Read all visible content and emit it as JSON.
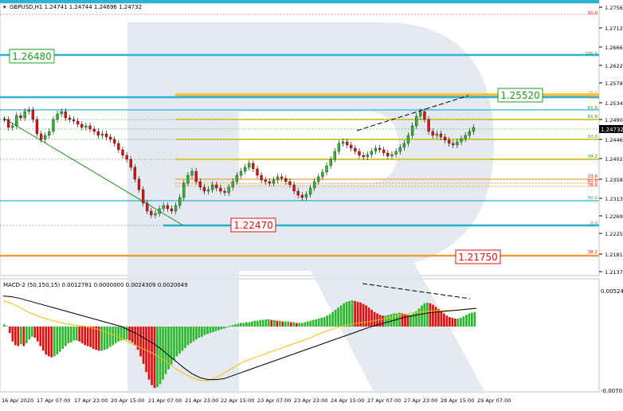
{
  "header": {
    "symbol_info": "GBPUSD,H1  1.24741 1.24744 1.24696 1.24732"
  },
  "macd": {
    "label": "MACD-2 (50,150,15) 0.0012781 0.0000000 0.0024309 0.0020049",
    "axis_top": "0.0052455",
    "axis_bottom": "-0.007019",
    "histogram": [
      0.0003,
      5e-05,
      -0.0007,
      -0.0016,
      -0.002,
      -0.0021,
      -0.0019,
      -0.0021,
      -0.0018,
      -0.0014,
      -0.0011,
      -0.0012,
      -0.0016,
      -0.0021,
      -0.0026,
      -0.003,
      -0.0032,
      -0.0033,
      -0.0032,
      -0.003,
      -0.0027,
      -0.0024,
      -0.0021,
      -0.0018,
      -0.0017,
      -0.0015,
      -0.0015,
      -0.0016,
      -0.0018,
      -0.002,
      -0.0021,
      -0.0022,
      -0.0024,
      -0.0025,
      -0.0026,
      -0.0026,
      -0.0025,
      -0.0024,
      -0.0022,
      -0.002,
      -0.0018,
      -0.0016,
      -0.0015,
      -0.0014,
      -0.0014,
      -0.0015,
      -0.0017,
      -0.002,
      -0.0025,
      -0.0032,
      -0.004,
      -0.0049,
      -0.0057,
      -0.0063,
      -0.0066,
      -0.0065,
      -0.0062,
      -0.0057,
      -0.0051,
      -0.0046,
      -0.0041,
      -0.0036,
      -0.0032,
      -0.0029,
      -0.0026,
      -0.0023,
      -0.002,
      -0.0018,
      -0.0016,
      -0.0014,
      -0.0012,
      -0.0011,
      -0.0009,
      -0.0008,
      -0.0007,
      -0.0006,
      -0.0005,
      -0.0004,
      -0.0003,
      -0.0002,
      -0.0001,
      0.0001,
      0.0002,
      0.0003,
      0.0004,
      0.0005,
      0.0005,
      0.0006,
      0.0006,
      0.0007,
      0.0008,
      0.0008,
      0.0009,
      0.0009,
      0.001,
      0.001,
      0.0009,
      0.0009,
      0.0008,
      0.0008,
      0.0007,
      0.0007,
      0.0007,
      0.0006,
      0.0006,
      0.0005,
      0.0005,
      0.0005,
      0.0006,
      0.0007,
      0.0008,
      0.0009,
      0.001,
      0.0011,
      0.0012,
      0.0013,
      0.0015,
      0.0017,
      0.002,
      0.0023,
      0.0026,
      0.0029,
      0.0032,
      0.0034,
      0.0035,
      0.0036,
      0.0035,
      0.0034,
      0.0033,
      0.0031,
      0.0029,
      0.0026,
      0.0023,
      0.002,
      0.0018,
      0.0016,
      0.0015,
      0.0015,
      0.0016,
      0.0017,
      0.0018,
      0.0018,
      0.0019,
      0.0018,
      0.0017,
      0.0016,
      0.0016,
      0.0018,
      0.0021,
      0.0025,
      0.0029,
      0.0032,
      0.0033,
      0.0032,
      0.003,
      0.0027,
      0.0024,
      0.0021,
      0.0018,
      0.0015,
      0.0013,
      0.0012,
      0.0011,
      0.0011,
      0.0012,
      0.0014,
      0.0016,
      0.0018,
      0.0019,
      0.002
    ],
    "signal": [
      0.0035,
      0.0032,
      0.0027,
      0.0021,
      0.0016,
      0.0012,
      0.0009,
      0.0006,
      0.0004,
      0.0002,
      0.0001,
      -0.0001,
      -0.0003,
      -0.0006,
      -0.0009,
      -0.0013,
      -0.0017,
      -0.0021,
      -0.0025,
      -0.0029,
      -0.0034,
      -0.004,
      -0.0046,
      -0.0051,
      -0.0055,
      -0.0058,
      -0.0058,
      -0.0055,
      -0.005,
      -0.0045,
      -0.004,
      -0.0036,
      -0.0033,
      -0.003,
      -0.0027,
      -0.0024,
      -0.0021,
      -0.0018,
      -0.0015,
      -0.0012,
      -0.0008,
      -0.0005,
      -0.0002,
      0.0001,
      0.0003,
      0.0005,
      0.0006,
      0.0008,
      0.001,
      0.0012,
      0.0015,
      0.0017,
      0.0019,
      0.002,
      0.0021,
      0.0022,
      0.0022,
      0.0022,
      0.0023,
      0.0024,
      0.0025
    ],
    "macd_line": [
      0.0042,
      0.0041,
      0.0039,
      0.0036,
      0.0033,
      0.003,
      0.0027,
      0.0024,
      0.0021,
      0.0018,
      0.0015,
      0.0012,
      0.0009,
      0.0006,
      0.0003,
      0.0,
      -0.0004,
      -0.0008,
      -0.0013,
      -0.0018,
      -0.0024,
      -0.0031,
      -0.0038,
      -0.0045,
      -0.0051,
      -0.0055,
      -0.0057,
      -0.0057,
      -0.0056,
      -0.0053,
      -0.005,
      -0.0047,
      -0.0044,
      -0.0041,
      -0.0038,
      -0.0035,
      -0.0032,
      -0.0029,
      -0.0026,
      -0.0023,
      -0.002,
      -0.0017,
      -0.0014,
      -0.0011,
      -0.0008,
      -0.0005,
      -0.0002,
      0.0001,
      0.0004,
      0.0007,
      0.001,
      0.0013,
      0.0015,
      0.0017,
      0.0019,
      0.002,
      0.0021,
      0.0022,
      0.0023,
      0.0024,
      0.0025
    ]
  },
  "price_axis": {
    "ticks": [
      "1.27560",
      "1.27120",
      "1.26660",
      "1.26220",
      "1.25780",
      "1.25340",
      "1.24900",
      "1.24460",
      "1.24020",
      "1.23580",
      "1.23130",
      "1.22690",
      "1.22250",
      "1.21810",
      "1.21370"
    ],
    "current_price": "1.24732"
  },
  "time_axis": {
    "labels": [
      "16 Apr 2020",
      "17 Apr 07:00",
      "17 Apr 23:00",
      "20 Apr 15:00",
      "21 Apr 07:00",
      "21 Apr 23:00",
      "22 Apr 15:00",
      "23 Apr 07:00",
      "23 Apr 23:00",
      "24 Apr 15:00",
      "27 Apr 07:00",
      "27 Apr 23:00",
      "28 Apr 15:00",
      "29 Apr 07:00"
    ]
  },
  "levels": {
    "big_labels": {
      "upper_left": "1.26480",
      "upper_right": "1.25520",
      "lower_mid": "1.22470",
      "lower_right": "1.21750"
    },
    "fib_left": [
      "50.0",
      "61.8",
      "38.2",
      "23.6",
      "0.0"
    ],
    "fib_right": [
      "100.0",
      "76.0",
      "61.8",
      "61.8",
      "50.0",
      "38.2",
      "23.6",
      "76.0",
      "61.8",
      "50.0",
      "0.0",
      "38.2"
    ]
  },
  "colors": {
    "bull": "#2db82d",
    "bear": "#e01010",
    "cyan_line": "#2bb3d6",
    "yellow_line": "#e3c200",
    "orange_line": "#f0a030",
    "green_label": "#1e9e1e",
    "red_label": "#e01010",
    "signal": "#f0c000",
    "macd_line": "#000000"
  }
}
